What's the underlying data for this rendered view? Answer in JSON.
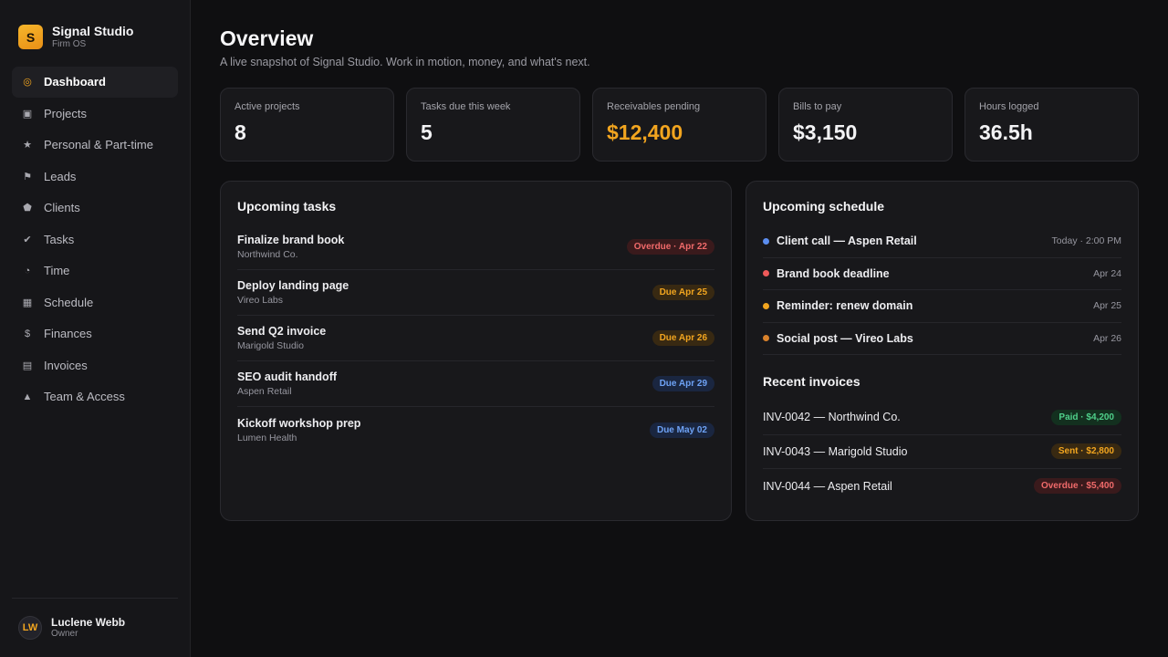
{
  "brand": {
    "logo_letter": "S",
    "name": "Signal Studio",
    "sub": "Firm OS"
  },
  "nav": [
    {
      "label": "Dashboard",
      "icon": "target-icon",
      "glyph": "◎",
      "active": true
    },
    {
      "label": "Projects",
      "icon": "square-icon",
      "glyph": "▣"
    },
    {
      "label": "Personal & Part-time",
      "icon": "star-icon",
      "glyph": "★"
    },
    {
      "label": "Leads",
      "icon": "flag-icon",
      "glyph": "⚑"
    },
    {
      "label": "Clients",
      "icon": "pentagon-icon",
      "glyph": "⬟"
    },
    {
      "label": "Tasks",
      "icon": "check-icon",
      "glyph": "✔"
    },
    {
      "label": "Time",
      "icon": "clock-icon",
      "glyph": "◔"
    },
    {
      "label": "Schedule",
      "icon": "grid-icon",
      "glyph": "▦"
    },
    {
      "label": "Finances",
      "icon": "dollar-icon",
      "glyph": "$"
    },
    {
      "label": "Invoices",
      "icon": "list-icon",
      "glyph": "▤"
    },
    {
      "label": "Team & Access",
      "icon": "triangle-icon",
      "glyph": "▲"
    }
  ],
  "user": {
    "initials": "LW",
    "name": "Luclene Webb",
    "role": "Owner"
  },
  "header": {
    "title": "Overview",
    "subtitle": "A live snapshot of Signal Studio. Work in motion, money, and what's next."
  },
  "stats": [
    {
      "label": "Active projects",
      "value": "8"
    },
    {
      "label": "Tasks due this week",
      "value": "5"
    },
    {
      "label": "Receivables pending",
      "value": "$12,400",
      "accent": true
    },
    {
      "label": "Bills to pay",
      "value": "$3,150"
    },
    {
      "label": "Hours logged",
      "value": "36.5h"
    }
  ],
  "tasks": {
    "title": "Upcoming tasks",
    "items": [
      {
        "title": "Finalize brand book",
        "client": "Northwind Co.",
        "badge": "Overdue · Apr 22",
        "tone": "red"
      },
      {
        "title": "Deploy landing page",
        "client": "Vireo Labs",
        "badge": "Due Apr 25",
        "tone": "amber"
      },
      {
        "title": "Send Q2 invoice",
        "client": "Marigold Studio",
        "badge": "Due Apr 26",
        "tone": "amber"
      },
      {
        "title": "SEO audit handoff",
        "client": "Aspen Retail",
        "badge": "Due Apr 29",
        "tone": "blue"
      },
      {
        "title": "Kickoff workshop prep",
        "client": "Lumen Health",
        "badge": "Due May 02",
        "tone": "blue"
      }
    ]
  },
  "schedule": {
    "title": "Upcoming schedule",
    "items": [
      {
        "title": "Client call — Aspen Retail",
        "when": "Today · 2:00 PM",
        "color": "#5b8def"
      },
      {
        "title": "Brand book deadline",
        "when": "Apr 24",
        "color": "#ef5a5a"
      },
      {
        "title": "Reminder: renew domain",
        "when": "Apr 25",
        "color": "#f2a51f"
      },
      {
        "title": "Social post — Vireo Labs",
        "when": "Apr 26",
        "color": "#d9822b"
      }
    ]
  },
  "invoices": {
    "title": "Recent invoices",
    "items": [
      {
        "title": "INV-0042 — Northwind Co.",
        "badge": "Paid · $4,200",
        "tone": "green"
      },
      {
        "title": "INV-0043 — Marigold Studio",
        "badge": "Sent · $2,800",
        "tone": "amber"
      },
      {
        "title": "INV-0044 — Aspen Retail",
        "badge": "Overdue · $5,400",
        "tone": "red"
      }
    ]
  }
}
